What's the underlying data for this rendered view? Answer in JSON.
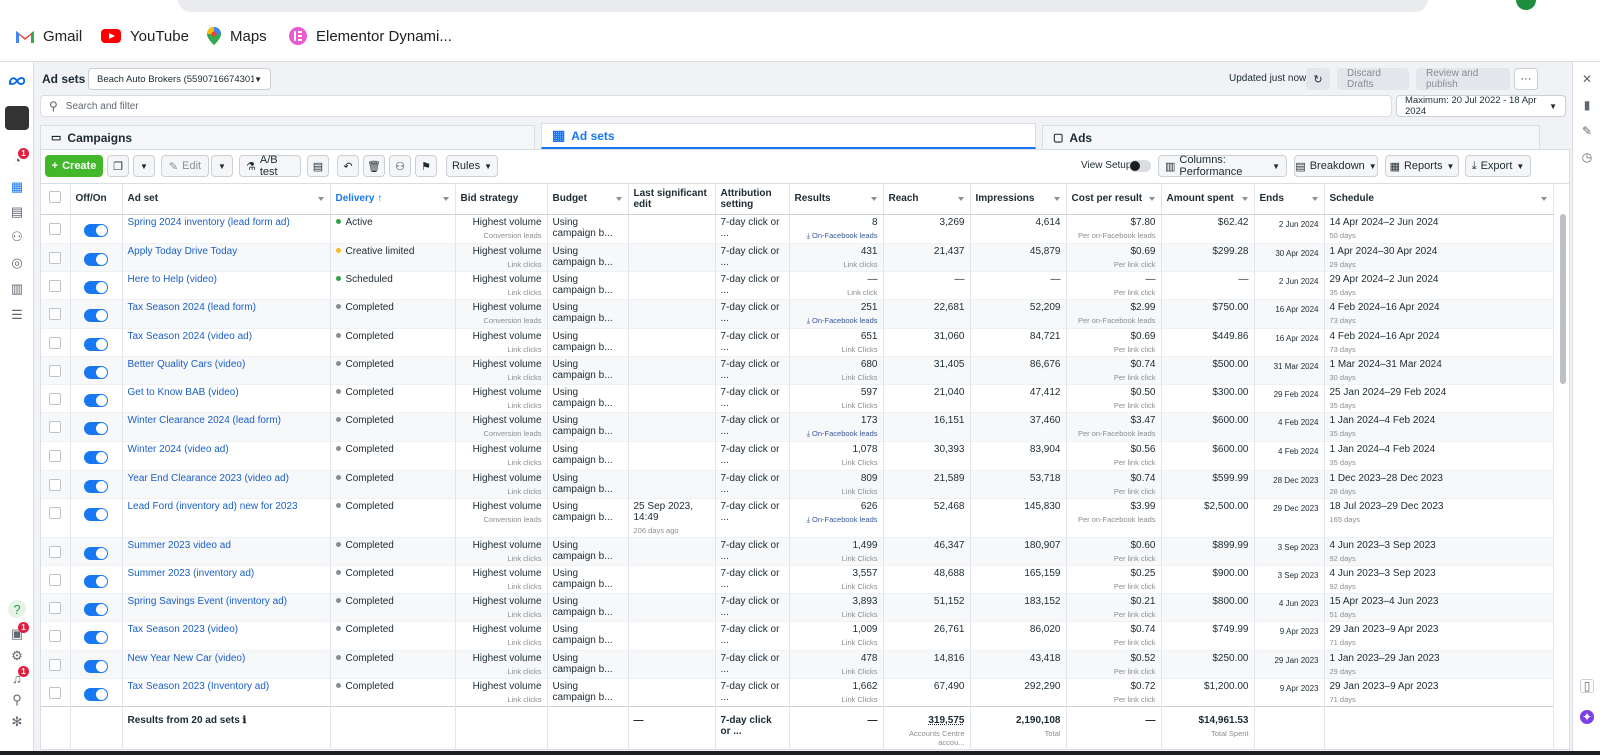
{
  "bookmarks": [
    {
      "label": "Gmail"
    },
    {
      "label": "YouTube"
    },
    {
      "label": "Maps"
    },
    {
      "label": "Elementor Dynami..."
    }
  ],
  "header": {
    "title": "Ad sets",
    "account": "Beach Auto Brokers (5590716674301...",
    "updated": "Updated just now",
    "discard": "Discard Drafts",
    "review": "Review and publish",
    "more": "···"
  },
  "search": {
    "placeholder": "Search and filter"
  },
  "date_range": "Maximum: 20 Jul 2022 - 18 Apr 2024",
  "tabs": [
    {
      "label": "Campaigns"
    },
    {
      "label": "Ad sets"
    },
    {
      "label": "Ads"
    }
  ],
  "toolbar": {
    "create": "Create",
    "edit": "Edit",
    "ab_test": "A/B test",
    "rules": "Rules",
    "view_setup": "View Setup",
    "columns": "Columns: Performance",
    "breakdown": "Breakdown",
    "reports": "Reports",
    "export": "Export"
  },
  "columns": [
    "Off/On",
    "Ad set",
    "Delivery ↑",
    "Bid strategy",
    "Budget",
    "Last significant edit",
    "Attribution setting",
    "Results",
    "Reach",
    "Impressions",
    "Cost per result",
    "Amount spent",
    "Ends",
    "Schedule"
  ],
  "rows": [
    {
      "name": "Spring 2024 inventory (lead form ad)",
      "delivery": "Active",
      "dcolor": "#31a24c",
      "bid": "Highest volume",
      "bidsub": "Conversion leads",
      "budget": "Using campaign b...",
      "edit": "",
      "editsub": "",
      "attr": "7-day click or ...",
      "results": "8",
      "rsub": "⤓ On-Facebook leads",
      "rblue": true,
      "reach": "3,269",
      "impr": "4,614",
      "cpr": "$7.80",
      "cprsub": "Per on-Facebook leads",
      "spent": "$62.42",
      "ends": "2 Jun 2024",
      "sched": "14 Apr 2024–2 Jun 2024",
      "schedsub": "50 days"
    },
    {
      "name": "Apply Today Drive Today",
      "delivery": "Creative limited",
      "dcolor": "#f7b928",
      "bid": "Highest volume",
      "bidsub": "Link clicks",
      "budget": "Using campaign b...",
      "edit": "",
      "editsub": "",
      "attr": "7-day click or ...",
      "results": "431",
      "rsub": "Link clicks",
      "rblue": false,
      "reach": "21,437",
      "impr": "45,879",
      "cpr": "$0.69",
      "cprsub": "Per link click",
      "spent": "$299.28",
      "ends": "30 Apr 2024",
      "sched": "1 Apr 2024–30 Apr 2024",
      "schedsub": "29 days"
    },
    {
      "name": "Here to Help (video)",
      "delivery": "Scheduled",
      "dcolor": "#31a24c",
      "bid": "Highest volume",
      "bidsub": "Link clicks",
      "budget": "Using campaign b...",
      "edit": "",
      "editsub": "",
      "attr": "7-day click or ...",
      "results": "—",
      "rsub": "Link click",
      "rblue": false,
      "reach": "—",
      "impr": "—",
      "cpr": "—",
      "cprsub": "Per link click",
      "spent": "—",
      "ends": "2 Jun 2024",
      "sched": "29 Apr 2024–2 Jun 2024",
      "schedsub": "35 days"
    },
    {
      "name": "Tax Season 2024 (lead form)",
      "delivery": "Completed",
      "dcolor": "#8a8d91",
      "bid": "Highest volume",
      "bidsub": "Conversion leads",
      "budget": "Using campaign b...",
      "edit": "",
      "editsub": "",
      "attr": "7-day click or ...",
      "results": "251",
      "rsub": "⤓ On-Facebook leads",
      "rblue": true,
      "reach": "22,681",
      "impr": "52,209",
      "cpr": "$2.99",
      "cprsub": "Per on-Facebook leads",
      "spent": "$750.00",
      "ends": "16 Apr 2024",
      "sched": "4 Feb 2024–16 Apr 2024",
      "schedsub": "73 days"
    },
    {
      "name": "Tax Season 2024 (video ad)",
      "delivery": "Completed",
      "dcolor": "#8a8d91",
      "bid": "Highest volume",
      "bidsub": "Link clicks",
      "budget": "Using campaign b...",
      "edit": "",
      "editsub": "",
      "attr": "7-day click or ...",
      "results": "651",
      "rsub": "Link Clicks",
      "rblue": false,
      "reach": "31,060",
      "impr": "84,721",
      "cpr": "$0.69",
      "cprsub": "Per link click",
      "spent": "$449.86",
      "ends": "16 Apr 2024",
      "sched": "4 Feb 2024–16 Apr 2024",
      "schedsub": "73 days"
    },
    {
      "name": "Better Quality Cars (video)",
      "delivery": "Completed",
      "dcolor": "#8a8d91",
      "bid": "Highest volume",
      "bidsub": "Link clicks",
      "budget": "Using campaign b...",
      "edit": "",
      "editsub": "",
      "attr": "7-day click or ...",
      "results": "680",
      "rsub": "Link Clicks",
      "rblue": false,
      "reach": "31,405",
      "impr": "86,676",
      "cpr": "$0.74",
      "cprsub": "Per link click",
      "spent": "$500.00",
      "ends": "31 Mar 2024",
      "sched": "1 Mar 2024–31 Mar 2024",
      "schedsub": "30 days"
    },
    {
      "name": "Get to Know BAB (video)",
      "delivery": "Completed",
      "dcolor": "#8a8d91",
      "bid": "Highest volume",
      "bidsub": "Link clicks",
      "budget": "Using campaign b...",
      "edit": "",
      "editsub": "",
      "attr": "7-day click or ...",
      "results": "597",
      "rsub": "Link Clicks",
      "rblue": false,
      "reach": "21,040",
      "impr": "47,412",
      "cpr": "$0.50",
      "cprsub": "Per link click",
      "spent": "$300.00",
      "ends": "29 Feb 2024",
      "sched": "25 Jan 2024–29 Feb 2024",
      "schedsub": "35 days"
    },
    {
      "name": "Winter Clearance 2024 (lead form)",
      "delivery": "Completed",
      "dcolor": "#8a8d91",
      "bid": "Highest volume",
      "bidsub": "Conversion leads",
      "budget": "Using campaign b...",
      "edit": "",
      "editsub": "",
      "attr": "7-day click or ...",
      "results": "173",
      "rsub": "⤓ On-Facebook leads",
      "rblue": true,
      "reach": "16,151",
      "impr": "37,460",
      "cpr": "$3.47",
      "cprsub": "Per on-Facebook leads",
      "spent": "$600.00",
      "ends": "4 Feb 2024",
      "sched": "1 Jan 2024–4 Feb 2024",
      "schedsub": "35 days"
    },
    {
      "name": "Winter 2024 (video ad)",
      "delivery": "Completed",
      "dcolor": "#8a8d91",
      "bid": "Highest volume",
      "bidsub": "Link clicks",
      "budget": "Using campaign b...",
      "edit": "",
      "editsub": "",
      "attr": "7-day click or ...",
      "results": "1,078",
      "rsub": "Link Clicks",
      "rblue": false,
      "reach": "30,393",
      "impr": "83,904",
      "cpr": "$0.56",
      "cprsub": "Per link click",
      "spent": "$600.00",
      "ends": "4 Feb 2024",
      "sched": "1 Jan 2024–4 Feb 2024",
      "schedsub": "35 days"
    },
    {
      "name": "Year End Clearance 2023 (video ad)",
      "delivery": "Completed",
      "dcolor": "#8a8d91",
      "bid": "Highest volume",
      "bidsub": "Link clicks",
      "budget": "Using campaign b...",
      "edit": "",
      "editsub": "",
      "attr": "7-day click or ...",
      "results": "809",
      "rsub": "Link Clicks",
      "rblue": false,
      "reach": "21,589",
      "impr": "53,718",
      "cpr": "$0.74",
      "cprsub": "Per link click",
      "spent": "$599.99",
      "ends": "28 Dec 2023",
      "sched": "1 Dec 2023–28 Dec 2023",
      "schedsub": "28 days"
    },
    {
      "name": "Lead Ford (inventory ad) new for 2023",
      "delivery": "Completed",
      "dcolor": "#8a8d91",
      "bid": "Highest volume",
      "bidsub": "Conversion leads",
      "budget": "Using campaign b...",
      "edit": "25 Sep 2023, 14:49",
      "editsub": "206 days ago",
      "attr": "7-day click or ...",
      "results": "626",
      "rsub": "⤓ On-Facebook leads",
      "rblue": true,
      "reach": "52,468",
      "impr": "145,830",
      "cpr": "$3.99",
      "cprsub": "Per on-Facebook leads",
      "spent": "$2,500.00",
      "ends": "29 Dec 2023",
      "sched": "18 Jul 2023–29 Dec 2023",
      "schedsub": "165 days"
    },
    {
      "name": "Summer 2023 video ad",
      "delivery": "Completed",
      "dcolor": "#8a8d91",
      "bid": "Highest volume",
      "bidsub": "Link clicks",
      "budget": "Using campaign b...",
      "edit": "",
      "editsub": "",
      "attr": "7-day click or ...",
      "results": "1,499",
      "rsub": "Link Clicks",
      "rblue": false,
      "reach": "46,347",
      "impr": "180,907",
      "cpr": "$0.60",
      "cprsub": "Per link click",
      "spent": "$899.99",
      "ends": "3 Sep 2023",
      "sched": "4 Jun 2023–3 Sep 2023",
      "schedsub": "92 days"
    },
    {
      "name": "Summer 2023 (inventory ad)",
      "delivery": "Completed",
      "dcolor": "#8a8d91",
      "bid": "Highest volume",
      "bidsub": "Link clicks",
      "budget": "Using campaign b...",
      "edit": "",
      "editsub": "",
      "attr": "7-day click or ...",
      "results": "3,557",
      "rsub": "Link Clicks",
      "rblue": false,
      "reach": "48,688",
      "impr": "165,159",
      "cpr": "$0.25",
      "cprsub": "Per link click",
      "spent": "$900.00",
      "ends": "3 Sep 2023",
      "sched": "4 Jun 2023–3 Sep 2023",
      "schedsub": "92 days"
    },
    {
      "name": "Spring Savings Event (inventory ad)",
      "delivery": "Completed",
      "dcolor": "#8a8d91",
      "bid": "Highest volume",
      "bidsub": "Link clicks",
      "budget": "Using campaign b...",
      "edit": "",
      "editsub": "",
      "attr": "7-day click or ...",
      "results": "3,893",
      "rsub": "Link Clicks",
      "rblue": false,
      "reach": "51,152",
      "impr": "183,152",
      "cpr": "$0.21",
      "cprsub": "Per link click",
      "spent": "$800.00",
      "ends": "4 Jun 2023",
      "sched": "15 Apr 2023–4 Jun 2023",
      "schedsub": "51 days"
    },
    {
      "name": "Tax Season 2023 (video)",
      "delivery": "Completed",
      "dcolor": "#8a8d91",
      "bid": "Highest volume",
      "bidsub": "Link clicks",
      "budget": "Using campaign b...",
      "edit": "",
      "editsub": "",
      "attr": "7-day click or ...",
      "results": "1,009",
      "rsub": "Link Clicks",
      "rblue": false,
      "reach": "26,761",
      "impr": "86,020",
      "cpr": "$0.74",
      "cprsub": "Per link click",
      "spent": "$749.99",
      "ends": "9 Apr 2023",
      "sched": "29 Jan 2023–9 Apr 2023",
      "schedsub": "71 days"
    },
    {
      "name": "New Year New Car (video)",
      "delivery": "Completed",
      "dcolor": "#8a8d91",
      "bid": "Highest volume",
      "bidsub": "Link clicks",
      "budget": "Using campaign b...",
      "edit": "",
      "editsub": "",
      "attr": "7-day click or ...",
      "results": "478",
      "rsub": "Link Clicks",
      "rblue": false,
      "reach": "14,816",
      "impr": "43,418",
      "cpr": "$0.52",
      "cprsub": "Per link click",
      "spent": "$250.00",
      "ends": "29 Jan 2023",
      "sched": "1 Jan 2023–29 Jan 2023",
      "schedsub": "29 days"
    },
    {
      "name": "Tax Season 2023 (Inventory ad)",
      "delivery": "Completed",
      "dcolor": "#8a8d91",
      "bid": "Highest volume",
      "bidsub": "Link clicks",
      "budget": "Using campaign b...",
      "edit": "",
      "editsub": "",
      "attr": "7-day click or ...",
      "results": "1,662",
      "rsub": "Link Clicks",
      "rblue": false,
      "reach": "67,490",
      "impr": "292,290",
      "cpr": "$0.72",
      "cprsub": "Per link click",
      "spent": "$1,200.00",
      "ends": "9 Apr 2023",
      "sched": "29 Jan 2023–9 Apr 2023",
      "schedsub": "71 days"
    }
  ],
  "footer": {
    "label": "Results from 20 ad sets ℹ",
    "edit": "—",
    "attr": "7-day click or ...",
    "results": "—",
    "reach": "319,575",
    "reachsub": "Accounts Centre accou...",
    "impr": "2,190,108",
    "imprsub": "Total",
    "cpr": "—",
    "spent": "$14,961.53",
    "spentsub": "Total Spent"
  },
  "badges": {
    "notif": "1"
  }
}
